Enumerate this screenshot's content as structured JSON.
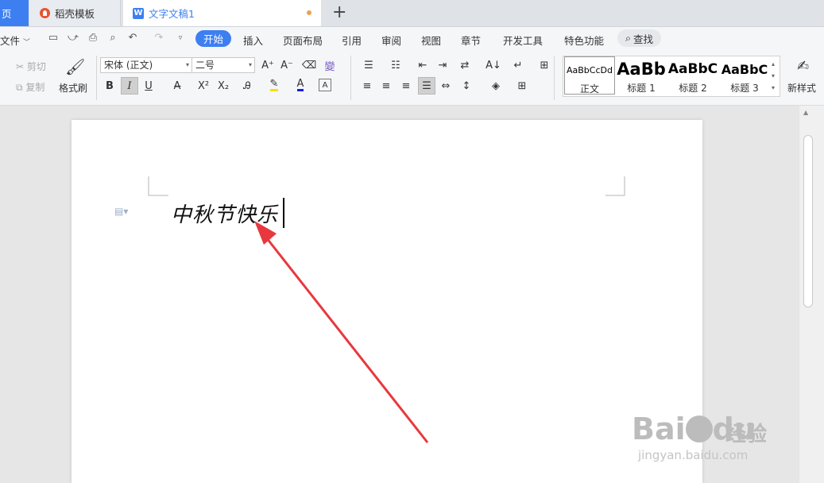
{
  "tabs": {
    "home_label": "页",
    "template_label": "稻壳模板",
    "doc_label": "文字文稿1"
  },
  "menu": {
    "file": "文件",
    "items": [
      "开始",
      "插入",
      "页面布局",
      "引用",
      "审阅",
      "视图",
      "章节",
      "开发工具",
      "特色功能"
    ],
    "search": "查找"
  },
  "ribbon": {
    "cut": "剪切",
    "copy": "复制",
    "format_painter": "格式刷",
    "font_name": "宋体 (正文)",
    "font_size": "二号",
    "bold": "B",
    "italic": "I",
    "underline": "U",
    "new_style": "新样式"
  },
  "styles": [
    {
      "preview": "AaBbCcDd",
      "name": "正文"
    },
    {
      "preview": "AaBb",
      "name": "标题 1"
    },
    {
      "preview": "AaBbC",
      "name": "标题 2"
    },
    {
      "preview": "AaBbC",
      "name": "标题 3"
    }
  ],
  "document": {
    "text": "中秋节快乐"
  },
  "watermark": {
    "brand": "Bai",
    "brand2": "du",
    "product": "经验",
    "url": "jingyan.baidu.com"
  },
  "colors": {
    "accent": "#3d7ff0",
    "arrow": "#e8383d",
    "highlight": "#f5e100",
    "font_color": "#1a1aee"
  }
}
